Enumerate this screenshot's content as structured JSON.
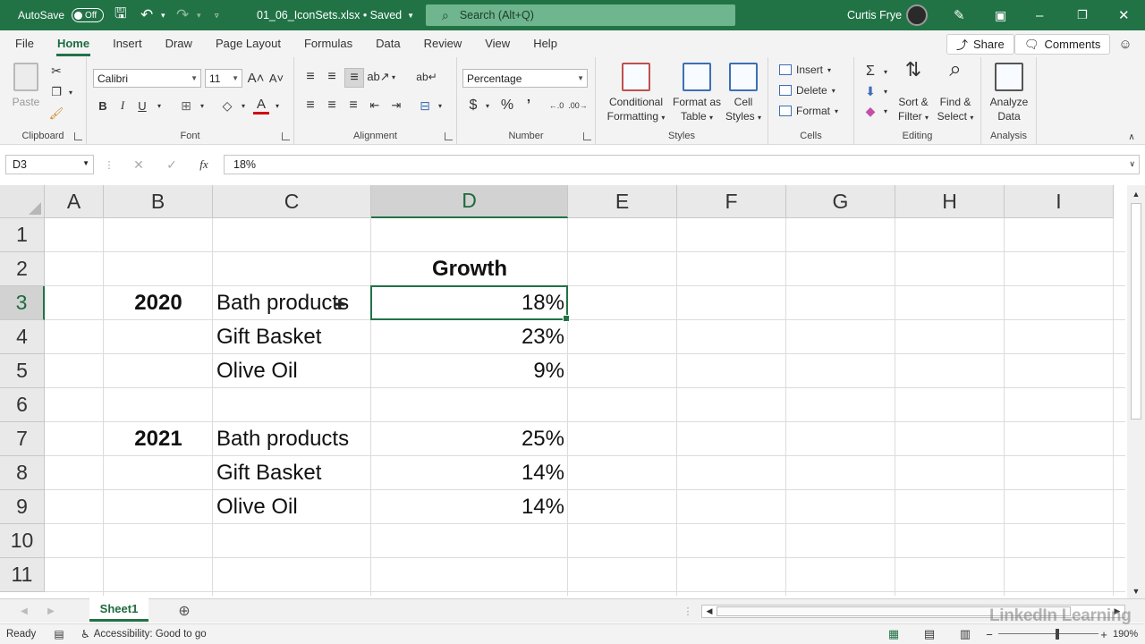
{
  "title": {
    "autosave_label": "AutoSave",
    "autosave_state": "Off",
    "filename": "01_06_IconSets.xlsx • Saved",
    "search_placeholder": "Search (Alt+Q)",
    "user_name": "Curtis Frye"
  },
  "tabs": [
    "File",
    "Home",
    "Insert",
    "Draw",
    "Page Layout",
    "Formulas",
    "Data",
    "Review",
    "View",
    "Help"
  ],
  "active_tab": "Home",
  "share_label": "Share",
  "comments_label": "Comments",
  "ribbon": {
    "clipboard": {
      "label": "Clipboard",
      "paste": "Paste"
    },
    "font": {
      "label": "Font",
      "family": "Calibri",
      "size": "11"
    },
    "alignment": {
      "label": "Alignment"
    },
    "number": {
      "label": "Number",
      "format": "Percentage"
    },
    "styles": {
      "label": "Styles",
      "conditional_1": "Conditional",
      "conditional_2": "Formatting",
      "format_table_1": "Format as",
      "format_table_2": "Table",
      "cell_styles_1": "Cell",
      "cell_styles_2": "Styles"
    },
    "cells": {
      "label": "Cells",
      "insert": "Insert",
      "delete": "Delete",
      "format": "Format"
    },
    "editing": {
      "label": "Editing",
      "sort_1": "Sort &",
      "sort_2": "Filter",
      "find_1": "Find &",
      "find_2": "Select"
    },
    "analysis": {
      "label": "Analysis",
      "analyze_1": "Analyze",
      "analyze_2": "Data"
    }
  },
  "formula_bar": {
    "name_box": "D3",
    "content": "18%"
  },
  "columns": [
    "A",
    "B",
    "C",
    "D",
    "E",
    "F",
    "G",
    "H",
    "I"
  ],
  "selected_column": "D",
  "rows": [
    "1",
    "2",
    "3",
    "4",
    "5",
    "6",
    "7",
    "8",
    "9",
    "10",
    "11"
  ],
  "selected_row": "3",
  "cells": {
    "D2": "Growth",
    "B3": "2020",
    "C3": "Bath products",
    "D3": "18%",
    "C4": "Gift Basket",
    "D4": "23%",
    "C5": "Olive Oil",
    "D5": "9%",
    "B7": "2021",
    "C7": "Bath products",
    "D7": "25%",
    "C8": "Gift Basket",
    "D8": "14%",
    "C9": "Olive Oil",
    "D9": "14%"
  },
  "sheet_tab": "Sheet1",
  "status": {
    "ready": "Ready",
    "accessibility": "Accessibility: Good to go",
    "zoom": "190%"
  },
  "watermark": "LinkedIn Learning"
}
